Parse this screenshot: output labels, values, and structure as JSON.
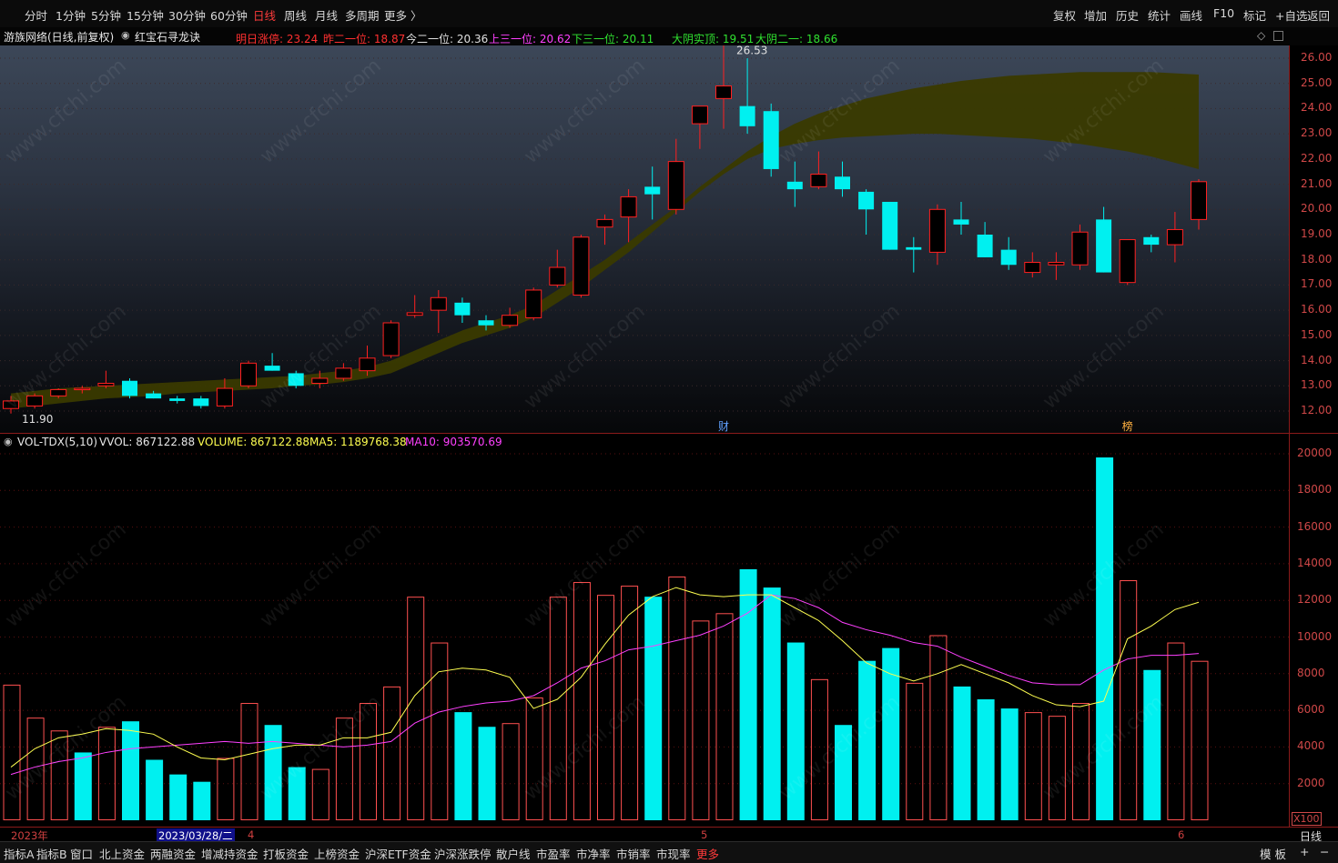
{
  "topbar": {
    "periods": [
      "分时",
      "1分钟",
      "5分钟",
      "15分钟",
      "30分钟",
      "60分钟",
      "日线",
      "周线",
      "月线",
      "多周期",
      "更多 〉"
    ],
    "active_period": "日线",
    "right_buttons": [
      "复权",
      "增加",
      "历史",
      "统计",
      "画线",
      "F10",
      "标记",
      "+自选",
      "返回"
    ]
  },
  "info": {
    "stock": "游族网络(日线,前复权)",
    "indicator": "红宝石寻龙诀",
    "items": [
      {
        "text": "明日涨停: 23.24",
        "color": "#ff3030"
      },
      {
        "text": "昨二一位: 18.87",
        "color": "#ff3030"
      },
      {
        "text": "今二一位: 20.36",
        "color": "#e0e0e0"
      },
      {
        "text": "上三一位: 20.62",
        "color": "#ff40ff"
      },
      {
        "text": "下三一位: 20.11",
        "color": "#30e030"
      },
      {
        "text": "大阴实顶: 19.51",
        "color": "#30e030"
      },
      {
        "text": "大阴二一: 18.66",
        "color": "#30e030"
      }
    ]
  },
  "colors": {
    "up": "#ff2020",
    "down": "#00f0f0",
    "band": "#3a3a00",
    "ma5": "#ffff50",
    "ma10": "#ff40ff",
    "axis": "#d04848",
    "grid": "#5a1010"
  },
  "price_axis": {
    "ticks": [
      "26.00",
      "25.00",
      "24.00",
      "23.00",
      "22.00",
      "21.00",
      "20.00",
      "19.00",
      "18.00",
      "17.00",
      "16.00",
      "15.00",
      "14.00",
      "13.00",
      "12.00"
    ],
    "min_tick": 12,
    "max_tick": 26,
    "max_label": "26.53",
    "min_label": "11.90"
  },
  "chart_data": [
    {
      "type": "candlestick",
      "title": "游族网络(日线,前复权)",
      "markers": [
        {
          "label": "财",
          "index": 30
        },
        {
          "label": "榜",
          "index": 47
        }
      ],
      "max_price": 26.53,
      "min_price": 11.9,
      "candles": [
        {
          "o": 12.1,
          "h": 12.6,
          "l": 11.9,
          "c": 12.4
        },
        {
          "o": 12.2,
          "h": 12.7,
          "l": 12.1,
          "c": 12.6
        },
        {
          "o": 12.6,
          "h": 12.9,
          "l": 12.5,
          "c": 12.85
        },
        {
          "o": 12.85,
          "h": 13.0,
          "l": 12.7,
          "c": 12.9
        },
        {
          "o": 13.0,
          "h": 13.6,
          "l": 12.9,
          "c": 13.1
        },
        {
          "o": 13.2,
          "h": 13.3,
          "l": 12.5,
          "c": 12.6
        },
        {
          "o": 12.7,
          "h": 12.8,
          "l": 12.5,
          "c": 12.5
        },
        {
          "o": 12.5,
          "h": 12.6,
          "l": 12.3,
          "c": 12.4
        },
        {
          "o": 12.5,
          "h": 12.6,
          "l": 12.1,
          "c": 12.2
        },
        {
          "o": 12.2,
          "h": 13.3,
          "l": 12.1,
          "c": 12.9
        },
        {
          "o": 13.0,
          "h": 14.0,
          "l": 12.9,
          "c": 13.9
        },
        {
          "o": 13.8,
          "h": 14.3,
          "l": 13.6,
          "c": 13.6
        },
        {
          "o": 13.5,
          "h": 13.6,
          "l": 12.9,
          "c": 13.0
        },
        {
          "o": 13.1,
          "h": 13.6,
          "l": 12.9,
          "c": 13.3
        },
        {
          "o": 13.3,
          "h": 13.9,
          "l": 13.2,
          "c": 13.7
        },
        {
          "o": 13.6,
          "h": 14.6,
          "l": 13.4,
          "c": 14.1
        },
        {
          "o": 14.2,
          "h": 15.6,
          "l": 14.1,
          "c": 15.5
        },
        {
          "o": 15.8,
          "h": 16.6,
          "l": 15.7,
          "c": 15.9
        },
        {
          "o": 16.0,
          "h": 16.8,
          "l": 15.1,
          "c": 16.5
        },
        {
          "o": 16.3,
          "h": 16.5,
          "l": 15.5,
          "c": 15.8
        },
        {
          "o": 15.6,
          "h": 15.8,
          "l": 15.2,
          "c": 15.4
        },
        {
          "o": 15.4,
          "h": 16.1,
          "l": 15.3,
          "c": 15.8
        },
        {
          "o": 15.7,
          "h": 16.9,
          "l": 15.6,
          "c": 16.8
        },
        {
          "o": 17.0,
          "h": 18.4,
          "l": 16.9,
          "c": 17.7
        },
        {
          "o": 16.6,
          "h": 19.0,
          "l": 16.5,
          "c": 18.9
        },
        {
          "o": 19.3,
          "h": 19.8,
          "l": 18.6,
          "c": 19.6
        },
        {
          "o": 19.7,
          "h": 20.8,
          "l": 18.7,
          "c": 20.5
        },
        {
          "o": 20.9,
          "h": 21.7,
          "l": 19.6,
          "c": 20.6
        },
        {
          "o": 20.0,
          "h": 22.8,
          "l": 19.8,
          "c": 21.9
        },
        {
          "o": 23.4,
          "h": 23.6,
          "l": 22.4,
          "c": 24.1
        },
        {
          "o": 24.4,
          "h": 26.53,
          "l": 23.2,
          "c": 24.9
        },
        {
          "o": 24.1,
          "h": 26.0,
          "l": 23.0,
          "c": 23.3
        },
        {
          "o": 23.9,
          "h": 24.2,
          "l": 21.3,
          "c": 21.6
        },
        {
          "o": 21.1,
          "h": 21.9,
          "l": 20.1,
          "c": 20.8
        },
        {
          "o": 20.9,
          "h": 22.3,
          "l": 20.8,
          "c": 21.4
        },
        {
          "o": 21.3,
          "h": 21.9,
          "l": 20.5,
          "c": 20.8
        },
        {
          "o": 20.7,
          "h": 20.8,
          "l": 19.0,
          "c": 20.0
        },
        {
          "o": 20.3,
          "h": 20.3,
          "l": 18.4,
          "c": 18.4
        },
        {
          "o": 18.5,
          "h": 18.9,
          "l": 17.5,
          "c": 18.4
        },
        {
          "o": 18.3,
          "h": 20.2,
          "l": 17.8,
          "c": 20.0
        },
        {
          "o": 19.6,
          "h": 20.3,
          "l": 19.0,
          "c": 19.4
        },
        {
          "o": 19.0,
          "h": 19.5,
          "l": 18.1,
          "c": 18.1
        },
        {
          "o": 18.4,
          "h": 18.9,
          "l": 17.6,
          "c": 17.8
        },
        {
          "o": 17.5,
          "h": 18.3,
          "l": 17.3,
          "c": 17.9
        },
        {
          "o": 17.8,
          "h": 18.3,
          "l": 17.2,
          "c": 17.9
        },
        {
          "o": 17.8,
          "h": 19.4,
          "l": 17.6,
          "c": 19.1
        },
        {
          "o": 19.6,
          "h": 20.1,
          "l": 17.5,
          "c": 17.5
        },
        {
          "o": 17.1,
          "h": 18.8,
          "l": 17.0,
          "c": 18.8
        },
        {
          "o": 18.9,
          "h": 19.0,
          "l": 18.3,
          "c": 18.6
        },
        {
          "o": 18.6,
          "h": 19.9,
          "l": 17.9,
          "c": 19.2
        },
        {
          "o": 19.6,
          "h": 21.2,
          "l": 19.2,
          "c": 21.1
        }
      ],
      "band_upper": [
        12.7,
        12.8,
        12.9,
        12.95,
        13.0,
        13.05,
        13.1,
        13.15,
        13.2,
        13.25,
        13.3,
        13.35,
        13.4,
        13.5,
        13.6,
        13.75,
        14.0,
        14.4,
        14.8,
        15.2,
        15.5,
        15.8,
        16.2,
        16.8,
        17.4,
        18.0,
        18.7,
        19.4,
        20.1,
        20.9,
        21.6,
        22.3,
        22.9,
        23.4,
        23.8,
        24.1,
        24.4,
        24.6,
        24.8,
        24.95,
        25.1,
        25.2,
        25.3,
        25.35,
        25.4,
        25.45,
        25.45,
        25.45,
        25.45,
        25.4,
        25.35
      ],
      "band_lower": [
        12.1,
        12.2,
        12.3,
        12.4,
        12.5,
        12.55,
        12.6,
        12.7,
        12.75,
        12.8,
        12.85,
        12.9,
        13.0,
        13.05,
        13.15,
        13.3,
        13.5,
        13.9,
        14.3,
        14.7,
        15.0,
        15.3,
        15.7,
        16.3,
        16.9,
        17.6,
        18.3,
        19.1,
        19.9,
        20.7,
        21.4,
        22.0,
        22.4,
        22.6,
        22.75,
        22.85,
        22.9,
        22.95,
        23.0,
        23.0,
        22.95,
        22.9,
        22.85,
        22.8,
        22.7,
        22.6,
        22.45,
        22.3,
        22.1,
        21.85,
        21.6
      ]
    },
    {
      "type": "bar",
      "title": "VOL-TDX(5,10)",
      "ylabel": "X100",
      "yticks": [
        2000,
        4000,
        6000,
        8000,
        10000,
        12000,
        14000,
        16000,
        18000,
        20000
      ],
      "ylim": [
        0,
        21000
      ],
      "values": [
        7400,
        5600,
        4900,
        3700,
        5100,
        5400,
        3300,
        2500,
        2100,
        3400,
        6400,
        5200,
        2900,
        2800,
        5600,
        6400,
        7300,
        12200,
        9700,
        5900,
        5100,
        5300,
        6700,
        12200,
        13000,
        12300,
        12800,
        12200,
        13300,
        10900,
        11300,
        13700,
        12700,
        9700,
        7700,
        5200,
        8700,
        9400,
        7500,
        10100,
        7300,
        6600,
        6100,
        5900,
        5700,
        6400,
        19800,
        13100,
        8200,
        9700,
        8700
      ],
      "ma5": [
        2900,
        3900,
        4500,
        4700,
        5000,
        4900,
        4700,
        4000,
        3400,
        3300,
        3600,
        3900,
        4100,
        4100,
        4500,
        4500,
        4800,
        6800,
        8100,
        8300,
        8200,
        7800,
        6100,
        6600,
        7800,
        9600,
        11200,
        12200,
        12700,
        12300,
        12200,
        12300,
        12300,
        11600,
        10900,
        9800,
        8600,
        8000,
        7600,
        8000,
        8500,
        8000,
        7500,
        6800,
        6300,
        6200,
        6500,
        9900,
        10600,
        11500,
        11900
      ],
      "ma10": [
        2500,
        2900,
        3200,
        3400,
        3700,
        3900,
        4000,
        4100,
        4200,
        4300,
        4200,
        4300,
        4200,
        4100,
        4000,
        4100,
        4300,
        5300,
        5900,
        6200,
        6400,
        6500,
        6800,
        7500,
        8300,
        8700,
        9300,
        9500,
        9800,
        10100,
        10600,
        11300,
        12300,
        12100,
        11600,
        10800,
        10400,
        10100,
        9700,
        9500,
        8900,
        8400,
        7900,
        7500,
        7400,
        7400,
        8200,
        8800,
        9000,
        9000,
        9100
      ],
      "colors": [
        "up",
        "up",
        "up",
        "down",
        "up",
        "down",
        "down",
        "down",
        "down",
        "up",
        "up",
        "down",
        "down",
        "up",
        "up",
        "up",
        "up",
        "up",
        "up",
        "down",
        "down",
        "up",
        "up",
        "up",
        "up",
        "up",
        "up",
        "down",
        "up",
        "up",
        "up",
        "down",
        "down",
        "down",
        "up",
        "down",
        "down",
        "down",
        "up",
        "up",
        "down",
        "down",
        "down",
        "up",
        "up",
        "up",
        "down",
        "up",
        "down",
        "up",
        "up"
      ]
    }
  ],
  "volume_info": {
    "name": "VOL-TDX(5,10)",
    "vvol": "VVOL: 867122.88",
    "volume": "VOLUME: 867122.88",
    "ma5": "MA5: 1189768.38",
    "ma10": "MA10: 903570.69"
  },
  "vol_axis": {
    "unit": "X100"
  },
  "dates": {
    "year": "2023年",
    "cursor": "2023/03/28/二",
    "m4": "4",
    "m5": "5",
    "m6": "6",
    "period": "日线"
  },
  "bottom_tabs": [
    "指标A",
    "指标B",
    "窗口",
    "北上资金",
    "两融资金",
    "增减持资金",
    "打板资金",
    "上榜资金",
    "沪深ETF资金",
    "沪深涨跌停",
    "散户线",
    "市盈率",
    "市净率",
    "市销率",
    "市现率",
    "更多"
  ],
  "bottom_right": [
    "模 板",
    "+",
    "−"
  ],
  "watermark": "www.cfchi.com"
}
